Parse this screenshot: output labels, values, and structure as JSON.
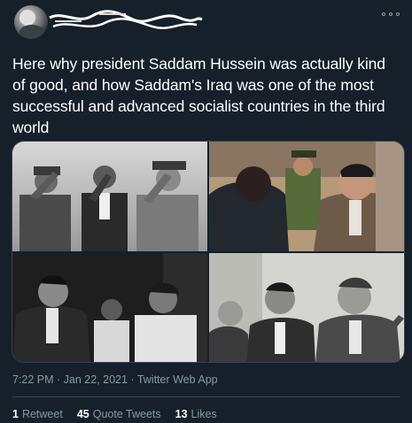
{
  "tweet": {
    "text": "Here why president Saddam Hussein was actually kind of good, and how Saddam's Iraq was one of the most successful and advanced socialist countries in the third world",
    "timestamp": "7:22 PM · Jan 22, 2021 · Twitter Web App"
  },
  "stats": [
    {
      "count": "1",
      "label": "Retweet"
    },
    {
      "count": "45",
      "label": "Quote Tweets"
    },
    {
      "count": "13",
      "label": "Likes"
    }
  ],
  "icons": {
    "more": "more-options-icon",
    "avatar": "user-avatar"
  },
  "colors": {
    "background": "#15202b",
    "text": "#ffffff",
    "secondary_text": "#8899a6",
    "border": "#38444d"
  }
}
